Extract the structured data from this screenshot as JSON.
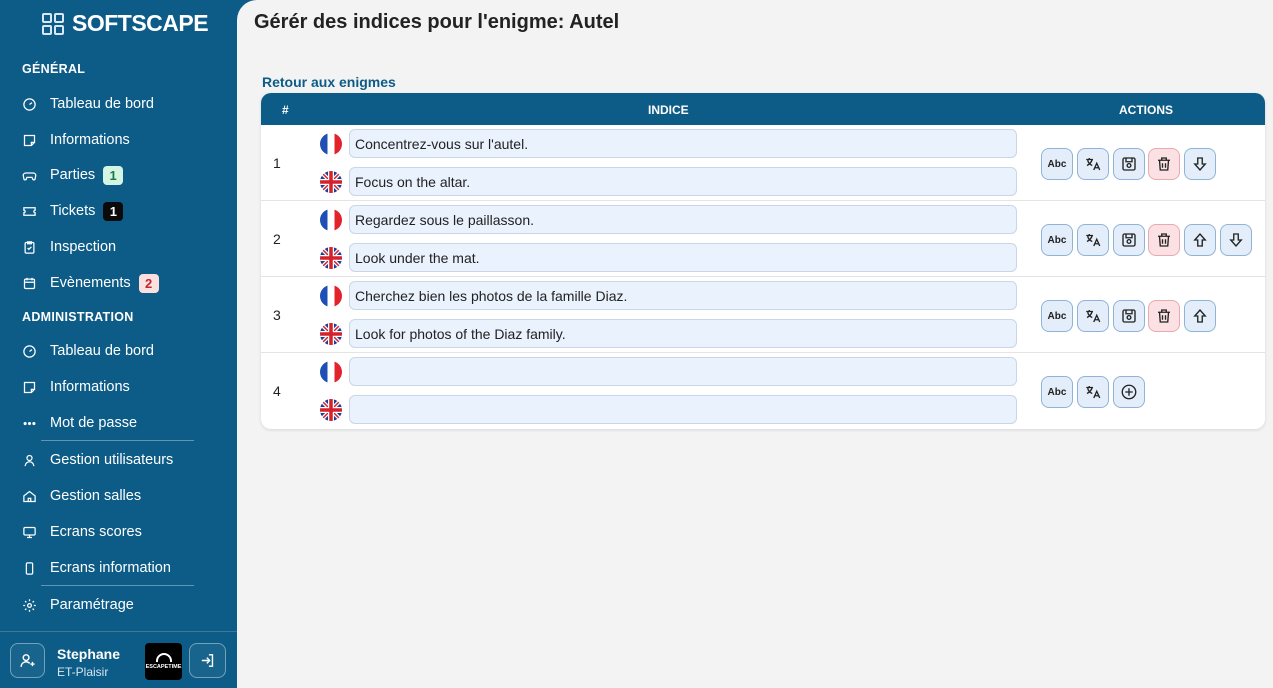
{
  "app": {
    "brand": "SOFTSCAPE"
  },
  "sidebar": {
    "general_title": "GÉNÉRAL",
    "general_items": [
      {
        "label": "Tableau de bord",
        "icon": "dashboard-icon"
      },
      {
        "label": "Informations",
        "icon": "info-card-icon"
      },
      {
        "label": "Parties",
        "icon": "gamepad-icon",
        "badge": "1"
      },
      {
        "label": "Tickets",
        "icon": "ticket-icon",
        "badge": "1"
      },
      {
        "label": "Inspection",
        "icon": "clipboard-icon"
      },
      {
        "label": "Evènements",
        "icon": "calendar-icon",
        "badge": "2"
      }
    ],
    "admin_title": "ADMINISTRATION",
    "admin_items": [
      {
        "label": "Tableau de bord",
        "icon": "dashboard-icon"
      },
      {
        "label": "Informations",
        "icon": "info-card-icon"
      },
      {
        "label": "Mot de passe",
        "icon": "password-dots-icon"
      },
      {
        "label": "Gestion utilisateurs",
        "icon": "user-icon"
      },
      {
        "label": "Gestion salles",
        "icon": "home-icon"
      },
      {
        "label": "Ecrans scores",
        "icon": "monitor-icon"
      },
      {
        "label": "Ecrans information",
        "icon": "phone-icon"
      },
      {
        "label": "Paramétrage",
        "icon": "settings-icon"
      }
    ],
    "badge_colors": {
      "green": "#d4f5e4",
      "black": "#0a0a0a",
      "red": "#fbe0e0"
    }
  },
  "user": {
    "name": "Stephane",
    "site": "ET-Plaisir",
    "venue_logo_text": "ESCAPETIME"
  },
  "main": {
    "title": "Gérér des indices pour l'enigme: Autel",
    "back_link": "Retour aux enigmes",
    "headers": {
      "num": "#",
      "hint": "INDICE",
      "actions": "ACTIONS"
    },
    "rows": [
      {
        "num": "1",
        "fr": "Concentrez-vous sur l'autel.",
        "en": "Focus on the altar.",
        "actions": [
          "spellcheck",
          "translate",
          "save",
          "delete",
          "move-down"
        ]
      },
      {
        "num": "2",
        "fr": "Regardez sous le paillasson.",
        "en": "Look under the mat.",
        "actions": [
          "spellcheck",
          "translate",
          "save",
          "delete",
          "move-up",
          "move-down"
        ]
      },
      {
        "num": "3",
        "fr": "Cherchez bien les photos de la famille Diaz.",
        "en": "Look for photos of the Diaz family.",
        "actions": [
          "spellcheck",
          "translate",
          "save",
          "delete",
          "move-up"
        ]
      },
      {
        "num": "4",
        "fr": "",
        "en": "",
        "actions": [
          "spellcheck",
          "translate",
          "add"
        ]
      }
    ],
    "spellcheck_label": "Abc"
  },
  "colors": {
    "primary": "#0d5c87",
    "field_bg": "#eaf2fd",
    "delete_bg": "#fbe1e3"
  }
}
